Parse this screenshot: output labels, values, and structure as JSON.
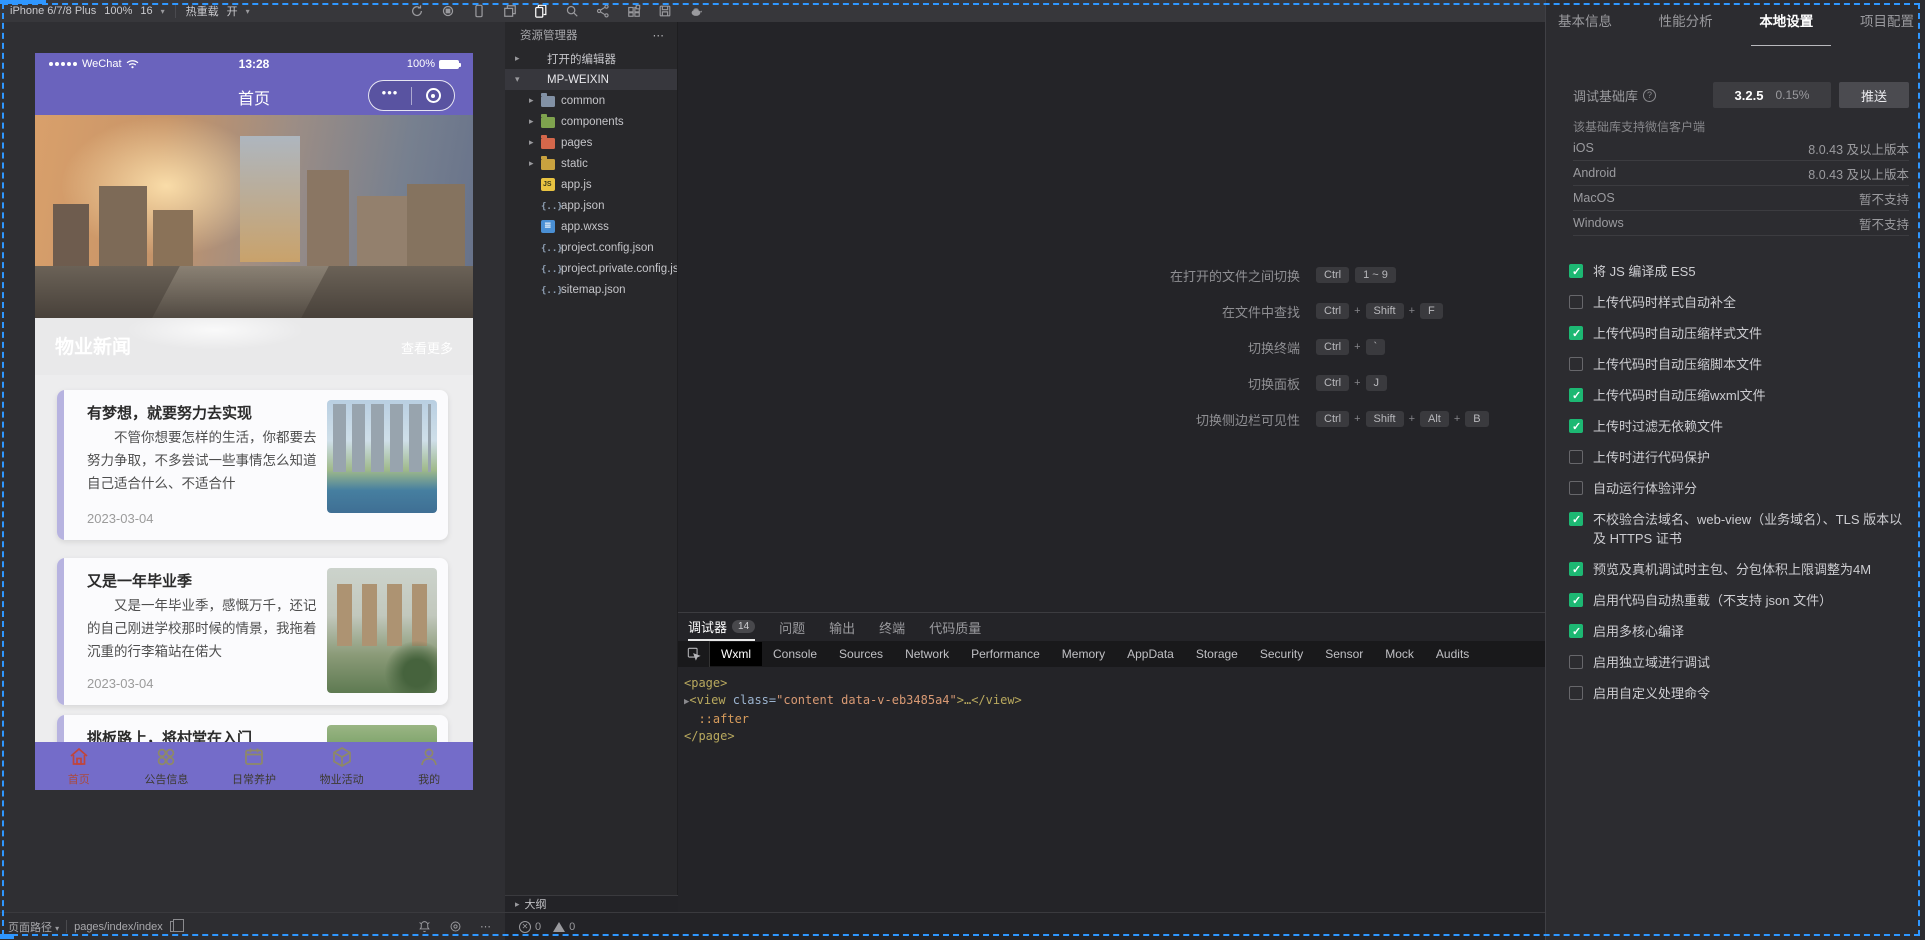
{
  "toolbar": {
    "device_label": "iPhone 6/7/8 Plus",
    "zoom_level": "100%",
    "font_size": "16",
    "hot_reload_label": "热重载",
    "hot_reload_state": "开",
    "caret": "▾"
  },
  "simulator": {
    "status": {
      "carrier": "WeChat",
      "time": "13:28",
      "battery": "100%"
    },
    "nav": {
      "title": "首页",
      "capsule_dots": "•••"
    },
    "news_band": {
      "title": "物业新闻",
      "more": "查看更多"
    },
    "cards": [
      {
        "title": "有梦想，就要努力去实现",
        "body": "不管你想要怎样的生活，你都要去努力争取，不多尝试一些事情怎么知道自己适合什么、不适合什",
        "date": "2023-03-04"
      },
      {
        "title": "又是一年毕业季",
        "body": "又是一年毕业季，感慨万千，还记的自己刚进学校那时候的情景，我拖着沉重的行李箱站在偌大",
        "date": "2023-03-04"
      },
      {
        "title": "挑板路上，将村堂在入门",
        "body": "",
        "date": ""
      }
    ],
    "tabbar": [
      {
        "label": "首页",
        "icon": "home",
        "active": true
      },
      {
        "label": "公告信息",
        "icon": "grid-circles",
        "active": false
      },
      {
        "label": "日常养护",
        "icon": "calendar",
        "active": false
      },
      {
        "label": "物业活动",
        "icon": "cube",
        "active": false
      },
      {
        "label": "我的",
        "icon": "person",
        "active": false
      }
    ]
  },
  "explorer": {
    "title": "资源管理器",
    "menu": "⋯",
    "tree": [
      {
        "arrow": "▸",
        "label": "打开的编辑器",
        "indent": 0,
        "icon": "",
        "selected": false
      },
      {
        "arrow": "▾",
        "label": "MP-WEIXIN",
        "indent": 0,
        "icon": "",
        "selected": true
      },
      {
        "arrow": "▸",
        "label": "common",
        "indent": 1,
        "icon": "folder-common",
        "selected": false
      },
      {
        "arrow": "▸",
        "label": "components",
        "indent": 1,
        "icon": "folder-components",
        "selected": false
      },
      {
        "arrow": "▸",
        "label": "pages",
        "indent": 1,
        "icon": "folder-pages",
        "selected": false
      },
      {
        "arrow": "▸",
        "label": "static",
        "indent": 1,
        "icon": "folder-static",
        "selected": false
      },
      {
        "arrow": "",
        "label": "app.js",
        "indent": 1,
        "icon": "file-js",
        "selected": false
      },
      {
        "arrow": "",
        "label": "app.json",
        "indent": 1,
        "icon": "file-json",
        "selected": false
      },
      {
        "arrow": "",
        "label": "app.wxss",
        "indent": 1,
        "icon": "file-wxss",
        "selected": false
      },
      {
        "arrow": "",
        "label": "project.config.json",
        "indent": 1,
        "icon": "file-json",
        "selected": false
      },
      {
        "arrow": "",
        "label": "project.private.config.js…",
        "indent": 1,
        "icon": "file-json",
        "selected": false
      },
      {
        "arrow": "",
        "label": "sitemap.json",
        "indent": 1,
        "icon": "file-json",
        "selected": false
      }
    ],
    "outline_label": "大纲",
    "outline_arrow": "▸"
  },
  "editor": {
    "shortcuts": [
      {
        "label": "在打开的文件之间切换",
        "keys": [
          "Ctrl",
          "1 ~ 9"
        ]
      },
      {
        "label": "在文件中查找",
        "keys": [
          "Ctrl",
          "+",
          "Shift",
          "+",
          "F"
        ]
      },
      {
        "label": "切换终端",
        "keys": [
          "Ctrl",
          "+",
          "`"
        ]
      },
      {
        "label": "切换面板",
        "keys": [
          "Ctrl",
          "+",
          "J"
        ]
      },
      {
        "label": "切换侧边栏可见性",
        "keys": [
          "Ctrl",
          "+",
          "Shift",
          "+",
          "Alt",
          "+",
          "B"
        ]
      }
    ]
  },
  "debugger": {
    "tabs": [
      {
        "label": "调试器",
        "badge": "14",
        "active": true
      },
      {
        "label": "问题",
        "badge": "",
        "active": false
      },
      {
        "label": "输出",
        "badge": "",
        "active": false
      },
      {
        "label": "终端",
        "badge": "",
        "active": false
      },
      {
        "label": "代码质量",
        "badge": "",
        "active": false
      }
    ],
    "subtabs": [
      {
        "label": "Wxml",
        "active": true
      },
      {
        "label": "Console",
        "active": false
      },
      {
        "label": "Sources",
        "active": false
      },
      {
        "label": "Network",
        "active": false
      },
      {
        "label": "Performance",
        "active": false
      },
      {
        "label": "Memory",
        "active": false
      },
      {
        "label": "AppData",
        "active": false
      },
      {
        "label": "Storage",
        "active": false
      },
      {
        "label": "Security",
        "active": false
      },
      {
        "label": "Sensor",
        "active": false
      },
      {
        "label": "Mock",
        "active": false
      },
      {
        "label": "Audits",
        "active": false
      }
    ],
    "code": {
      "l1": "<page>",
      "arrow": "▶",
      "tag_open": "<view",
      "attr": " class=",
      "value": "\"content data-v-eb3485a4\"",
      "rest": ">…</view>",
      "pseudo": "::after",
      "l4": "</page>"
    }
  },
  "statusbar": {
    "page_path_label": "页面路径",
    "caret": "▾",
    "path": "pages/index/index",
    "errors": "0",
    "warnings": "0"
  },
  "panel": {
    "tabs": [
      {
        "label": "基本信息",
        "active": false
      },
      {
        "label": "性能分析",
        "active": false
      },
      {
        "label": "本地设置",
        "active": true
      },
      {
        "label": "项目配置",
        "active": false
      }
    ],
    "base_lib": {
      "label": "调试基础库",
      "version": "3.2.5",
      "percent": "0.15%",
      "push": "推送",
      "support_note": "该基础库支持微信客户端"
    },
    "platforms": [
      {
        "name": "iOS",
        "value": "8.0.43 及以上版本"
      },
      {
        "name": "Android",
        "value": "8.0.43 及以上版本"
      },
      {
        "name": "MacOS",
        "value": "暂不支持"
      },
      {
        "name": "Windows",
        "value": "暂不支持"
      }
    ],
    "options": [
      {
        "label": "将 JS 编译成 ES5",
        "checked": true
      },
      {
        "label": "上传代码时样式自动补全",
        "checked": false
      },
      {
        "label": "上传代码时自动压缩样式文件",
        "checked": true
      },
      {
        "label": "上传代码时自动压缩脚本文件",
        "checked": false
      },
      {
        "label": "上传代码时自动压缩wxml文件",
        "checked": true
      },
      {
        "label": "上传时过滤无依赖文件",
        "checked": true
      },
      {
        "label": "上传时进行代码保护",
        "checked": false
      },
      {
        "label": "自动运行体验评分",
        "checked": false
      },
      {
        "label": "不校验合法域名、web-view（业务域名）、TLS 版本以及 HTTPS 证书",
        "checked": true
      },
      {
        "label": "预览及真机调试时主包、分包体积上限调整为4M",
        "checked": true
      },
      {
        "label": "启用代码自动热重载（不支持 json 文件）",
        "checked": true
      },
      {
        "label": "启用多核心编译",
        "checked": true
      },
      {
        "label": "启用独立域进行调试",
        "checked": false
      },
      {
        "label": "启用自定义处理命令",
        "checked": false
      }
    ]
  },
  "colors": {
    "accent_purple": "#6a63bd",
    "tabbar_purple": "#746cc9",
    "check_green": "#1db873",
    "marquee_blue": "#2f97ff"
  }
}
